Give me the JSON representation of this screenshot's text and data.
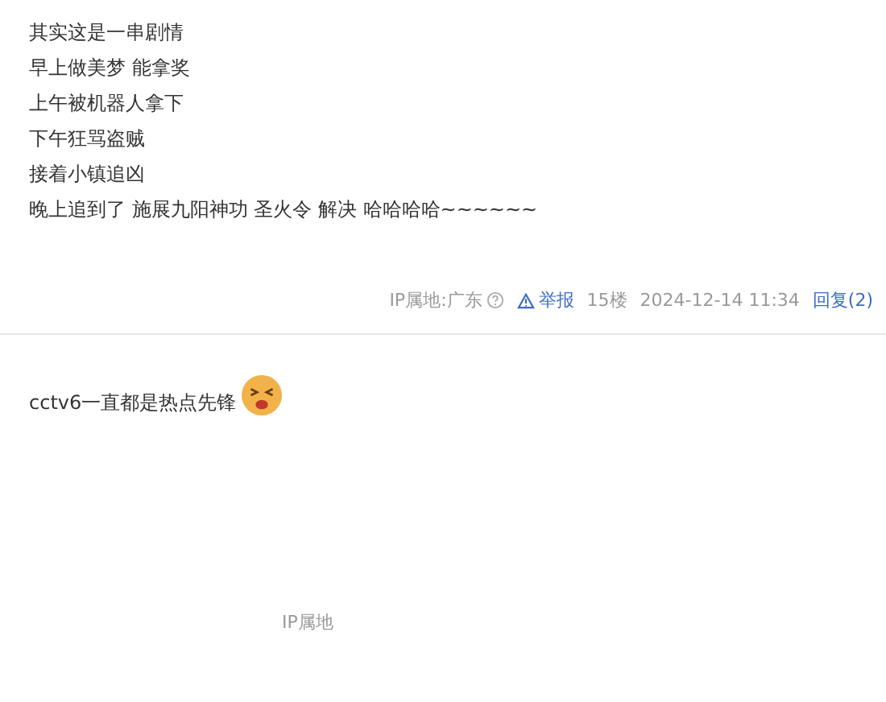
{
  "comments": [
    {
      "lines": [
        "其实这是一串剧情",
        "早上做美梦 能拿奖",
        "上午被机器人拿下",
        "下午狂骂盗贼",
        "接着小镇追凶",
        "晚上追到了 施展九阳神功 圣火令 解决 哈哈哈哈~~~~~~"
      ],
      "meta": {
        "ip": "IP属地:广东",
        "report": "举报",
        "floor": "15楼",
        "time": "2024-12-14 11:34",
        "reply": "回复(2)"
      }
    },
    {
      "lines": [
        "cctv6一直都是热点先锋"
      ],
      "emoji": true,
      "meta": {
        "ip": "IP属地"
      }
    }
  ]
}
